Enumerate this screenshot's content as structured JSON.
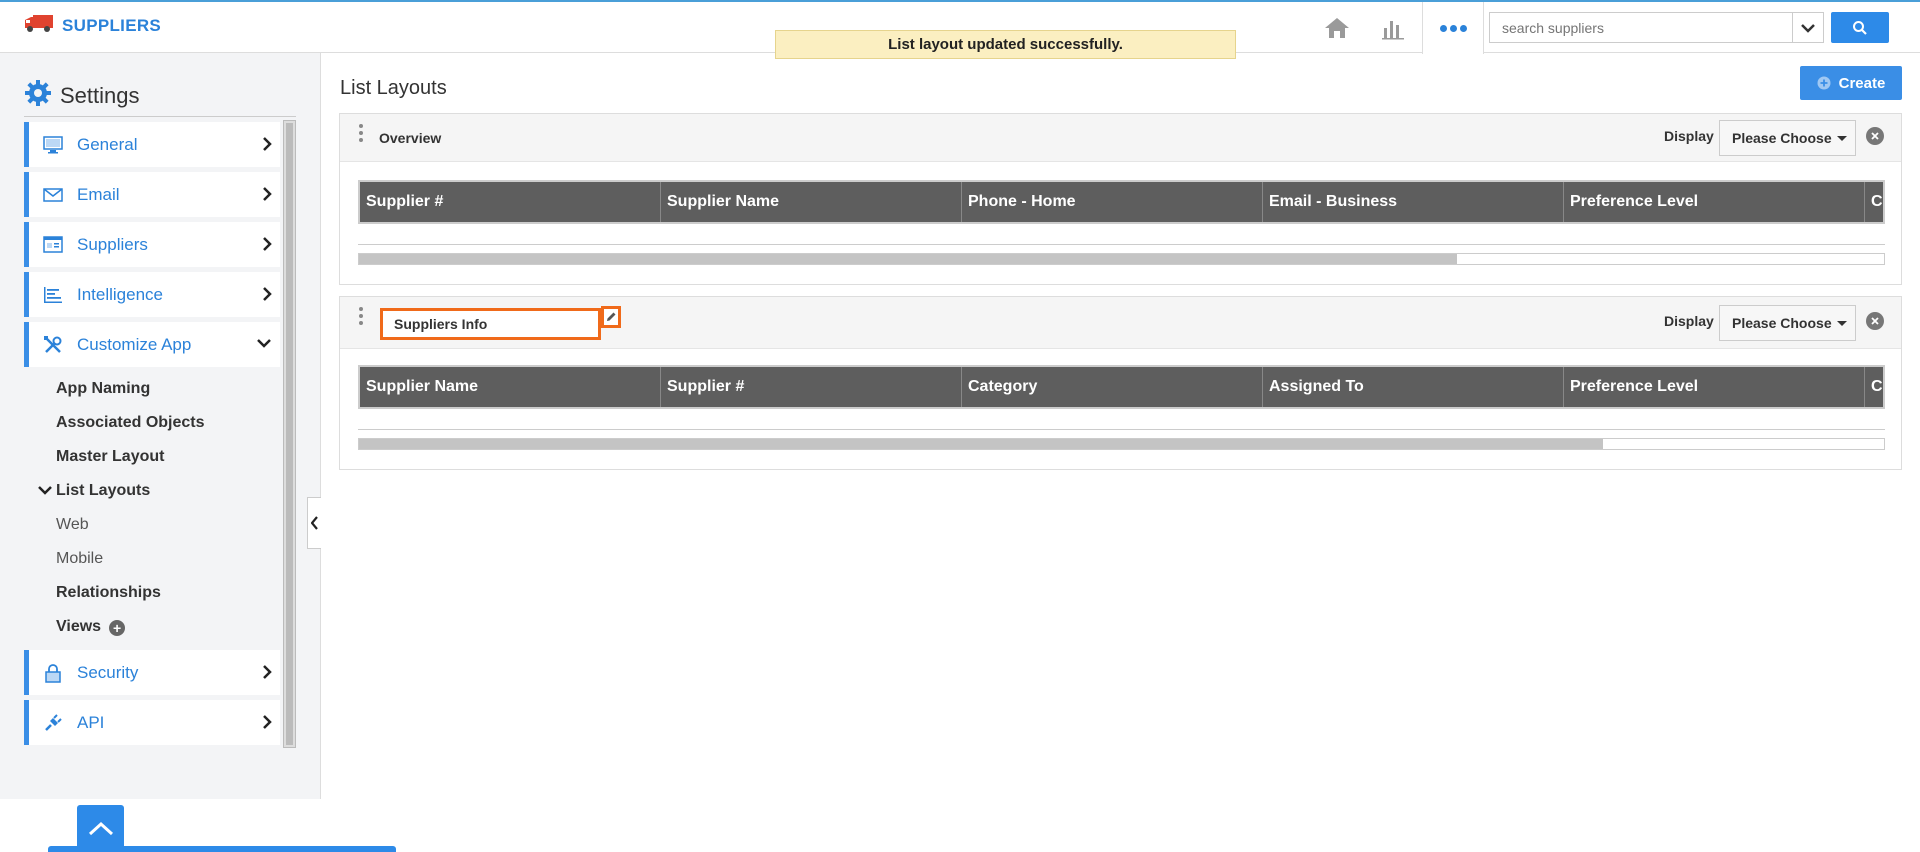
{
  "app": {
    "title": "SUPPLIERS",
    "accent_color": "#2b82d9",
    "truck_icon": "truck-icon"
  },
  "toast": {
    "message": "List layout updated successfully."
  },
  "topnav": {
    "icons": [
      "home-icon",
      "bar-chart-icon",
      "more-dots-icon"
    ],
    "search": {
      "placeholder": "search suppliers",
      "value": ""
    }
  },
  "sidebar": {
    "title": "Settings",
    "items": [
      {
        "label": "General",
        "icon": "monitor-icon"
      },
      {
        "label": "Email",
        "icon": "envelope-icon"
      },
      {
        "label": "Suppliers",
        "icon": "suppliers-icon"
      },
      {
        "label": "Intelligence",
        "icon": "intelligence-icon"
      },
      {
        "label": "Customize App",
        "icon": "tools-icon"
      }
    ],
    "customize_sub": [
      {
        "label": "App Naming"
      },
      {
        "label": "Associated Objects"
      },
      {
        "label": "Master Layout"
      },
      {
        "label": "List Layouts"
      },
      {
        "label": "Web"
      },
      {
        "label": "Mobile"
      },
      {
        "label": "Relationships"
      },
      {
        "label": "Views"
      }
    ],
    "bottom_items": [
      {
        "label": "Security",
        "icon": "lock-icon"
      },
      {
        "label": "API",
        "icon": "plug-icon"
      }
    ]
  },
  "main": {
    "title": "List Layouts",
    "create_label": "Create",
    "layouts": [
      {
        "name": "Overview",
        "display_label": "Display",
        "display_value": "Please Choose",
        "columns": [
          "Supplier #",
          "Supplier Name",
          "Phone - Home",
          "Email - Business",
          "Preference Level",
          "C"
        ],
        "scroll_fraction": 0.72
      },
      {
        "name": "Suppliers Info",
        "display_label": "Display",
        "display_value": "Please Choose",
        "columns": [
          "Supplier Name",
          "Supplier #",
          "Category",
          "Assigned To",
          "Preference Level",
          "C"
        ],
        "scroll_fraction": 0.816
      }
    ]
  }
}
